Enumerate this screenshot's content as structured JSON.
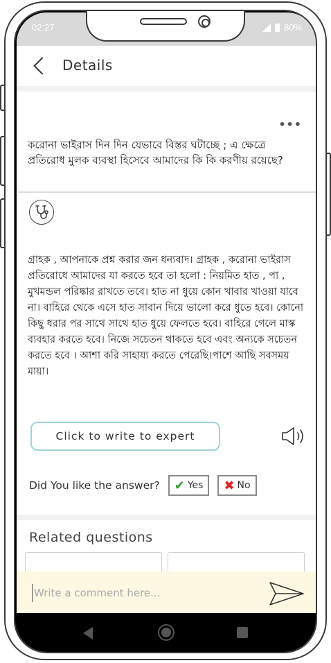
{
  "status_bar": {
    "time": "02:27",
    "battery": "80%"
  },
  "header": {
    "title": "Details"
  },
  "question": {
    "text": "করোনা ভাইরাস দিন দিন যেভাবে বিস্তর ঘটাচ্ছে ; এ ক্ষেত্রে প্রতিরোধ মুলক ব্যবস্থা হিসেবে আমাদের কি কি করণীয় রয়েছে?"
  },
  "answer": {
    "text": "গ্রাহক , আপনাকে প্রশ্ন করার জন ধন্যবাদ। গ্রাহক , করোনা ভাইরাস প্রতিরোধে আমাদের যা করতে হবে তা হলো : নিয়মিত হাত , পা , মুখমন্ডল পরিষ্কার রাখতে তবে। হাত না ধুয়ে কোন খাবার খাওয়া যাবে না। বাহিরে থেকে এসে হাত সাবান দিয়ে ভালো করে ধুতে হবে। কোনো কিছু ধরার পর সাথে সাথে হাত ধুয়ে ফেলতে হবে। বাহিরে গেলে মাস্ক ব্যবহার করতে হবে। নিজে সচেতন থাকতে হবে এবং অন্যকে সচেতন করতে হবে । আশা করি সাহায্য করতে পেরেছি।পাশে আছি সবসময় মায়া।"
  },
  "actions": {
    "write_expert_label": "Click to write to expert"
  },
  "feedback": {
    "question": "Did You like the answer?",
    "yes_label": "Yes",
    "no_label": "No"
  },
  "related": {
    "title": "Related questions"
  },
  "comment": {
    "placeholder": "Write a comment here..."
  },
  "colors": {
    "accent_border": "#9fd2dc",
    "comment_bg": "#fcf8e1",
    "yes_check": "#2e9e2e",
    "no_cross": "#e32020"
  },
  "icons": {
    "back": "chevron-left-icon",
    "more": "more-dots-icon",
    "expert": "stethoscope-icon",
    "audio": "speaker-icon",
    "send": "send-icon"
  }
}
